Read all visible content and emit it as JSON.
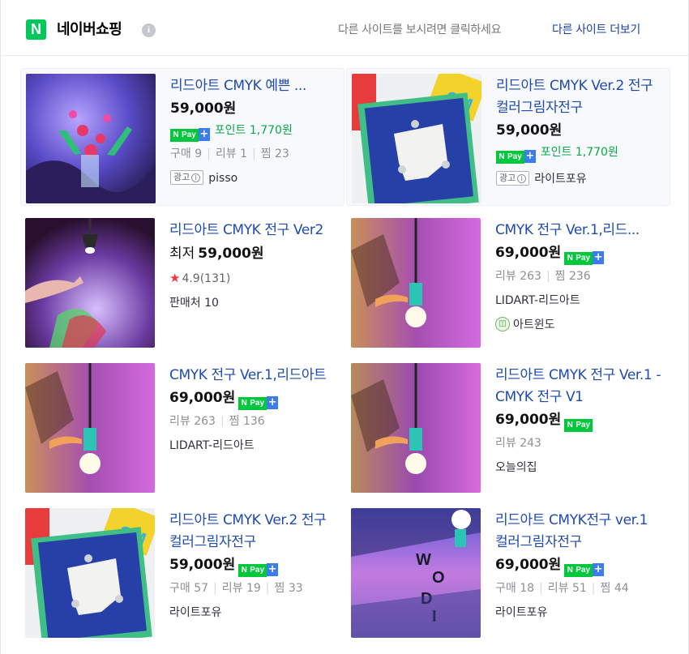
{
  "header": {
    "logo_letter": "N",
    "title": "네이버쇼핑",
    "info_glyph": "i",
    "hint": "다른 사이트를 보시려면 클릭하세요",
    "more_link": "다른 사이트 더보기"
  },
  "badges": {
    "npay_n": "N",
    "npay_pay": "Pay",
    "npay_plus": "+",
    "ad_label": "광고",
    "ad_info": "i",
    "star": "★",
    "stat_separator": "|"
  },
  "products": [
    {
      "name": "리드아트 CMYK 예쁜 ...",
      "price": "59,000원",
      "points": "포인트 1,770원",
      "stats": [
        "구매 9",
        "리뷰 1",
        "찜 23"
      ],
      "seller": "pisso"
    },
    {
      "name": "리드아트 CMYK Ver.2 전구 컬러그림자전구",
      "price": "59,000원",
      "points": "포인트 1,770원",
      "seller": "라이트포유"
    },
    {
      "name": "리드아트 CMYK 전구 Ver2",
      "price_prefix": "최저",
      "price": "59,000원",
      "rating": "4.9(131)",
      "seller_count": "판매처 10"
    },
    {
      "name": "CMYK 전구 Ver.1,리드...",
      "price": "69,000원",
      "stats": [
        "리뷰 263",
        "찜 236"
      ],
      "seller": "LIDART-리드아트",
      "shop": "아트윈도"
    },
    {
      "name": "CMYK 전구 Ver.1,리드아트",
      "price": "69,000원",
      "stats": [
        "리뷰 263",
        "찜 136"
      ],
      "seller": "LIDART-리드아트"
    },
    {
      "name": "리드아트 CMYK 전구 Ver.1 - CMYK 전구 V1",
      "price": "69,000원",
      "stats": [
        "리뷰 243"
      ],
      "seller": "오늘의집"
    },
    {
      "name": "리드아트 CMYK Ver.2 전구 컬러그림자전구",
      "price": "59,000원",
      "stats": [
        "구매 57",
        "리뷰 19",
        "찜 33"
      ],
      "seller": "라이트포유"
    },
    {
      "name": "리드아트 CMYK전구 ver.1 컬러그림자전구",
      "price": "69,000원",
      "stats": [
        "구매 18",
        "리뷰 51",
        "찜 44"
      ],
      "seller": "라이트포유"
    }
  ]
}
